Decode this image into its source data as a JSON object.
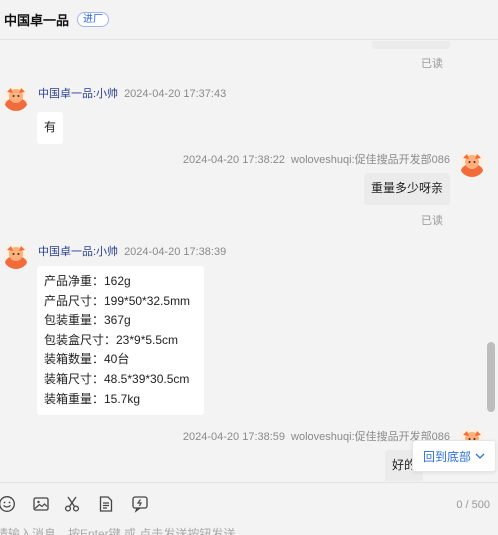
{
  "header": {
    "title": "中国卓一品",
    "tag": "进厂"
  },
  "messages": {
    "read_label": "已读",
    "m1": {
      "sender": "中国卓一品:小帅",
      "time": "2024-04-20 17:37:43",
      "text": "有"
    },
    "m2": {
      "sender": "woloveshuqi:促佳搜品开发部086",
      "time": "2024-04-20 17:38:22",
      "text": "重量多少呀亲"
    },
    "m3": {
      "sender": "中国卓一品:小帅",
      "time": "2024-04-20 17:38:39",
      "lines": [
        "产品净重：162g",
        "产品尺寸：199*50*32.5mm",
        "包装重量：367g",
        "包装盒尺寸：23*9*5.5cm",
        "装箱数量：40台",
        "装箱尺寸：48.5*39*30.5cm",
        "装箱重量：15.7kg"
      ]
    },
    "m4": {
      "sender": "woloveshuqi:促佳搜品开发部086",
      "time": "2024-04-20 17:38:59",
      "text": "好的"
    }
  },
  "back_to_bottom": "回到底部",
  "toolbar": {
    "icons": [
      "emoji-icon",
      "image-icon",
      "scissors-icon",
      "document-icon",
      "quick-reply-icon"
    ],
    "counter": "0 / 500",
    "placeholder": "请输入消息，按Enter键 或 点击发送按钮发送"
  },
  "colors": {
    "accent": "#2b6ed8",
    "name": "#2a3f8f",
    "bubble_self": "#ebebeb"
  }
}
